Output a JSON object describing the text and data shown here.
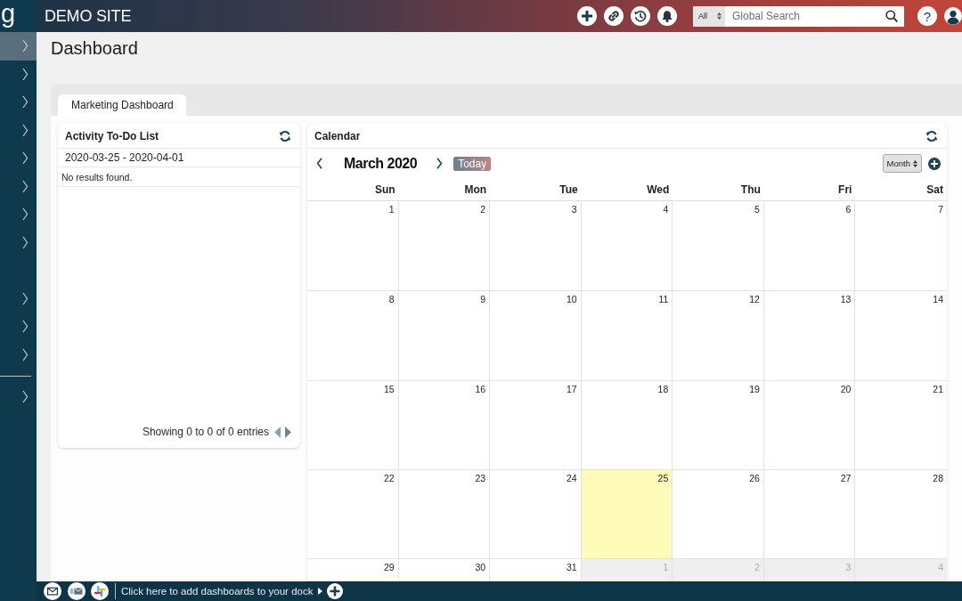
{
  "sidebar": {
    "logo": "g",
    "groups": [
      {
        "divider_before": false,
        "items": [
          {
            "selected": true
          },
          {
            "selected": false
          },
          {
            "selected": false
          },
          {
            "selected": false
          },
          {
            "selected": false
          },
          {
            "selected": false
          },
          {
            "selected": false
          },
          {
            "selected": false
          }
        ]
      },
      {
        "divider_before": false,
        "items": [
          {
            "selected": false
          },
          {
            "selected": false
          },
          {
            "selected": false
          }
        ]
      },
      {
        "divider_before": true,
        "items": [
          {
            "selected": false
          }
        ]
      }
    ]
  },
  "header": {
    "site_title": "DEMO SITE",
    "search": {
      "scope": "All",
      "placeholder": "Global Search"
    },
    "help": "?"
  },
  "page": {
    "title": "Dashboard",
    "tabs": [
      {
        "label": "Marketing Dashboard",
        "selected": true
      }
    ]
  },
  "todo_panel": {
    "title": "Activity To-Do List",
    "date_range": "2020-03-25 - 2020-04-01",
    "empty_message": "No results found.",
    "footer": "Showing 0 to 0 of 0 entries"
  },
  "calendar": {
    "title": "Calendar",
    "month_label": "March 2020",
    "today_button": "Today",
    "view_select": "Month",
    "weekdays": [
      "Sun",
      "Mon",
      "Tue",
      "Wed",
      "Thu",
      "Fri",
      "Sat"
    ],
    "weeks": [
      [
        {
          "day": "1",
          "today": false,
          "other_month": false
        },
        {
          "day": "2",
          "today": false,
          "other_month": false
        },
        {
          "day": "3",
          "today": false,
          "other_month": false
        },
        {
          "day": "4",
          "today": false,
          "other_month": false
        },
        {
          "day": "5",
          "today": false,
          "other_month": false
        },
        {
          "day": "6",
          "today": false,
          "other_month": false
        },
        {
          "day": "7",
          "today": false,
          "other_month": false
        }
      ],
      [
        {
          "day": "8",
          "today": false,
          "other_month": false
        },
        {
          "day": "9",
          "today": false,
          "other_month": false
        },
        {
          "day": "10",
          "today": false,
          "other_month": false
        },
        {
          "day": "11",
          "today": false,
          "other_month": false
        },
        {
          "day": "12",
          "today": false,
          "other_month": false
        },
        {
          "day": "13",
          "today": false,
          "other_month": false
        },
        {
          "day": "14",
          "today": false,
          "other_month": false
        }
      ],
      [
        {
          "day": "15",
          "today": false,
          "other_month": false
        },
        {
          "day": "16",
          "today": false,
          "other_month": false
        },
        {
          "day": "17",
          "today": false,
          "other_month": false
        },
        {
          "day": "18",
          "today": false,
          "other_month": false
        },
        {
          "day": "19",
          "today": false,
          "other_month": false
        },
        {
          "day": "20",
          "today": false,
          "other_month": false
        },
        {
          "day": "21",
          "today": false,
          "other_month": false
        }
      ],
      [
        {
          "day": "22",
          "today": false,
          "other_month": false
        },
        {
          "day": "23",
          "today": false,
          "other_month": false
        },
        {
          "day": "24",
          "today": false,
          "other_month": false
        },
        {
          "day": "25",
          "today": true,
          "other_month": false
        },
        {
          "day": "26",
          "today": false,
          "other_month": false
        },
        {
          "day": "27",
          "today": false,
          "other_month": false
        },
        {
          "day": "28",
          "today": false,
          "other_month": false
        }
      ],
      [
        {
          "day": "29",
          "today": false,
          "other_month": false
        },
        {
          "day": "30",
          "today": false,
          "other_month": false
        },
        {
          "day": "31",
          "today": false,
          "other_month": false
        },
        {
          "day": "1",
          "today": false,
          "other_month": true
        },
        {
          "day": "2",
          "today": false,
          "other_month": true
        },
        {
          "day": "3",
          "today": false,
          "other_month": true
        },
        {
          "day": "4",
          "today": false,
          "other_month": true
        }
      ]
    ]
  },
  "dock": {
    "prompt": "Click here to add dashboards to your dock"
  }
}
